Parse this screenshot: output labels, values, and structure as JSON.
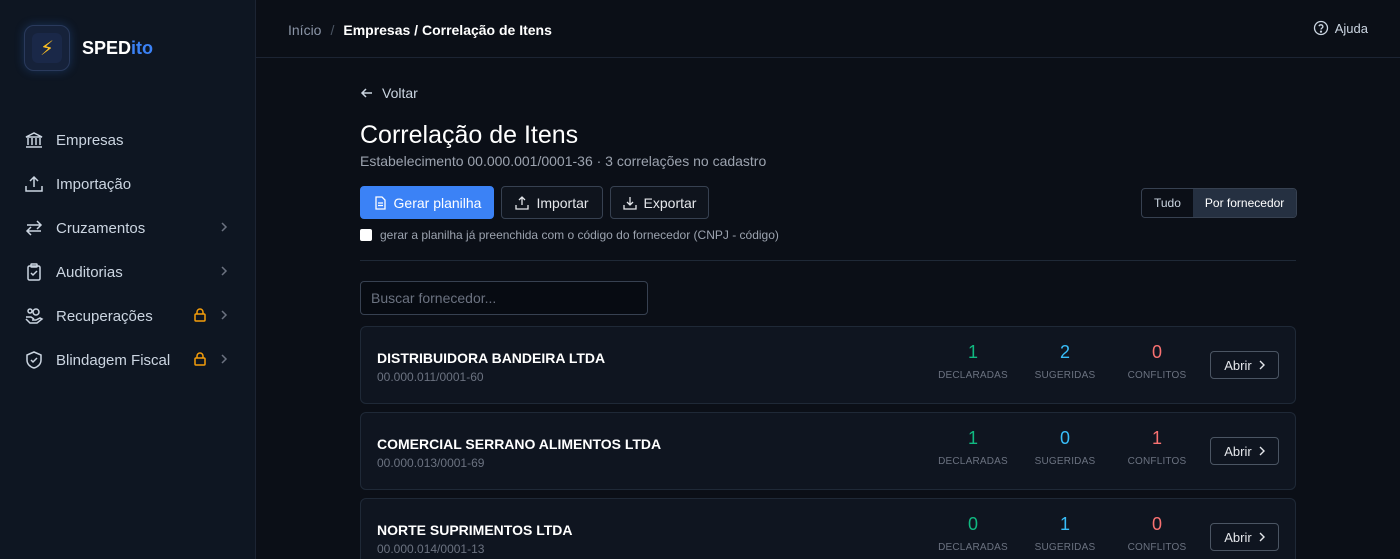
{
  "app": {
    "name_main": "SPED",
    "name_accent": "ito",
    "logo_glyph": "⚡"
  },
  "sidebar": {
    "items": [
      {
        "label": "Empresas",
        "icon": "bank-icon",
        "chevron": false,
        "locked": false
      },
      {
        "label": "Importação",
        "icon": "upload-icon",
        "chevron": false,
        "locked": false
      },
      {
        "label": "Cruzamentos",
        "icon": "arrows-swap-icon",
        "chevron": true,
        "locked": false
      },
      {
        "label": "Auditorias",
        "icon": "clipboard-check-icon",
        "chevron": true,
        "locked": false
      },
      {
        "label": "Recuperações",
        "icon": "hand-coins-icon",
        "chevron": true,
        "locked": true
      },
      {
        "label": "Blindagem Fiscal",
        "icon": "shield-check-icon",
        "chevron": true,
        "locked": true
      }
    ]
  },
  "topbar": {
    "breadcrumb_home": "Início",
    "breadcrumb_sep": "/",
    "breadcrumb_current": "Empresas / Correlação de Itens",
    "help_label": "Ajuda"
  },
  "main": {
    "back_label": "Voltar",
    "title": "Correlação de Itens",
    "subtitle": "Estabelecimento 00.000.001/0001-36 · 3 correlações no cadastro",
    "btn_generate": "Gerar planilha",
    "btn_import": "Importar",
    "btn_export": "Exportar",
    "view_all": "Tudo",
    "view_supplier": "Por fornecedor",
    "checkbox_label": "gerar a planilha já preenchida com o código do fornecedor (CNPJ - código)",
    "search_placeholder": "Buscar fornecedor...",
    "stat_labels": {
      "declared": "DECLARADAS",
      "suggested": "SUGERIDAS",
      "conflicts": "CONFLITOS"
    },
    "open_label": "Abrir"
  },
  "suppliers": [
    {
      "name": "DISTRIBUIDORA BANDEIRA LTDA",
      "cnpj": "00.000.011/0001-60",
      "declared": "1",
      "suggested": "2",
      "conflicts": "0"
    },
    {
      "name": "COMERCIAL SERRANO ALIMENTOS LTDA",
      "cnpj": "00.000.013/0001-69",
      "declared": "1",
      "suggested": "0",
      "conflicts": "1"
    },
    {
      "name": "NORTE SUPRIMENTOS LTDA",
      "cnpj": "00.000.014/0001-13",
      "declared": "0",
      "suggested": "1",
      "conflicts": "0"
    }
  ],
  "colors": {
    "accent": "#3b82f6",
    "declared": "#10b981",
    "suggested": "#38bdf8",
    "conflicts": "#f87171",
    "lock": "#f59e0b"
  }
}
